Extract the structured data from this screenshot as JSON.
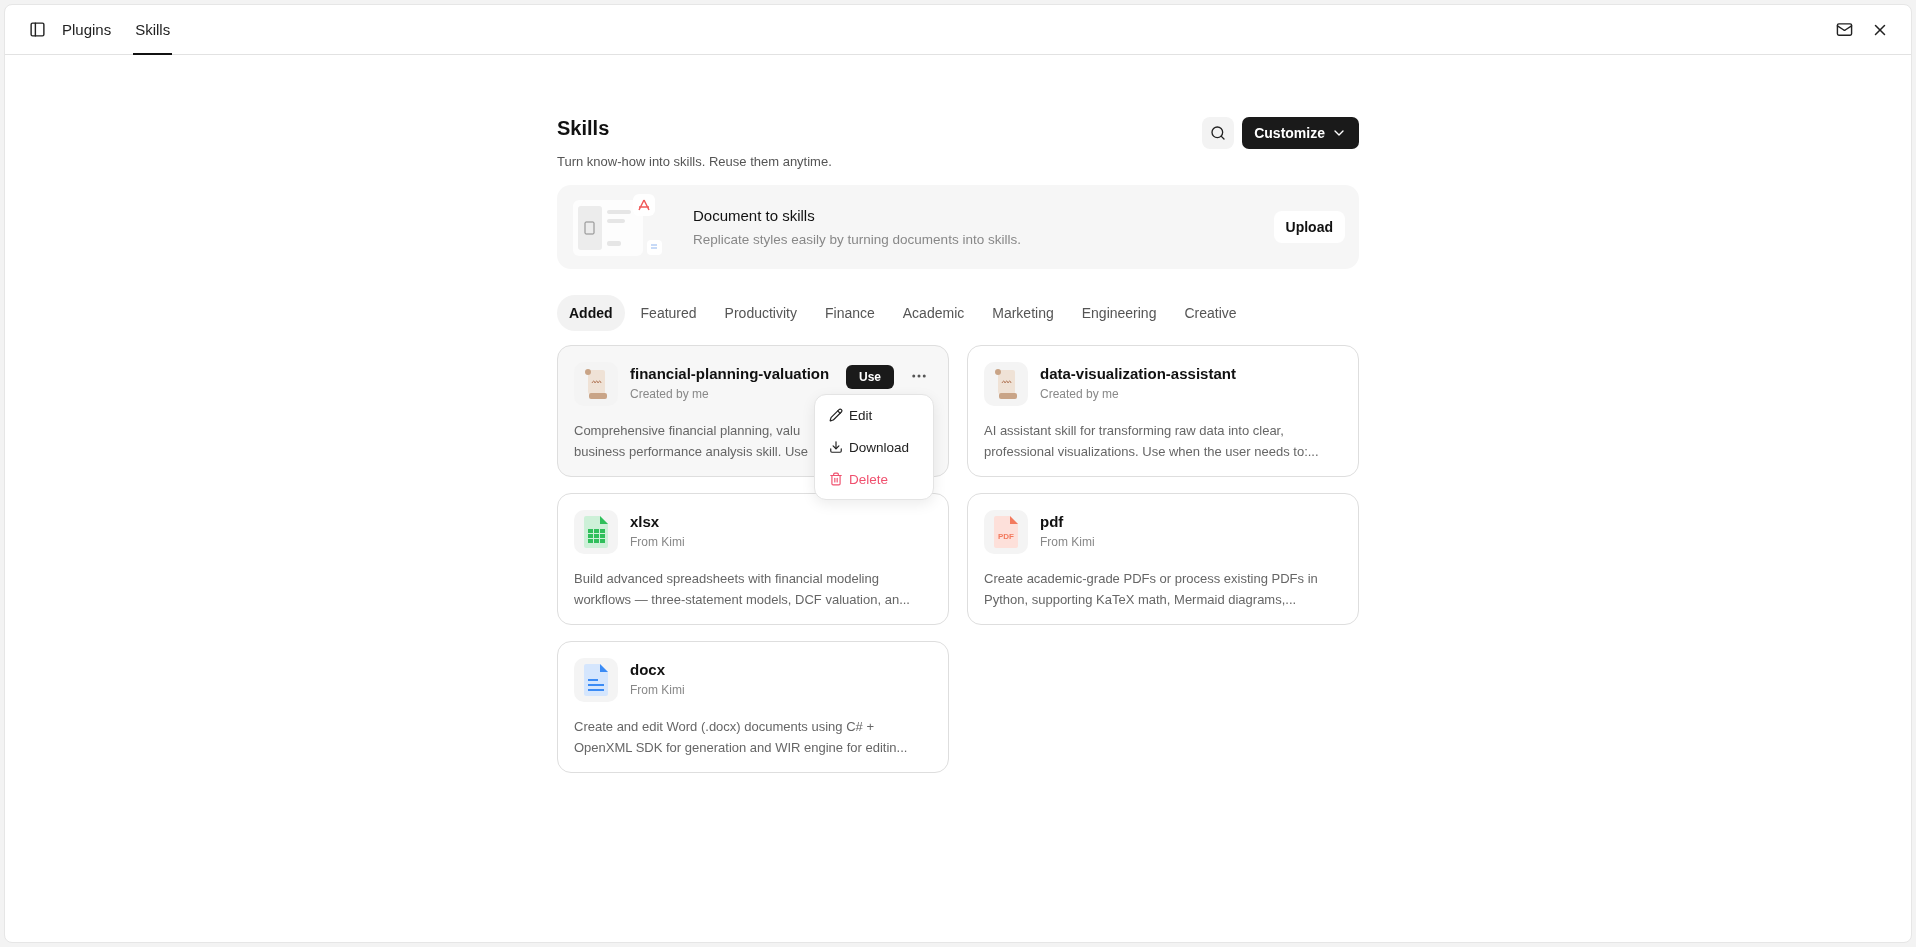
{
  "top_tabs": [
    {
      "label": "Plugins",
      "selected": false
    },
    {
      "label": "Skills",
      "selected": true
    }
  ],
  "header": {
    "title": "Skills",
    "subtitle": "Turn know-how into skills. Reuse them anytime.",
    "customize": "Customize"
  },
  "banner": {
    "title": "Document to skills",
    "subtitle": "Replicate styles easily by turning documents into skills.",
    "button": "Upload"
  },
  "category_tabs": [
    {
      "label": "Added",
      "selected": true
    },
    {
      "label": "Featured",
      "selected": false
    },
    {
      "label": "Productivity",
      "selected": false
    },
    {
      "label": "Finance",
      "selected": false
    },
    {
      "label": "Academic",
      "selected": false
    },
    {
      "label": "Marketing",
      "selected": false
    },
    {
      "label": "Engineering",
      "selected": false
    },
    {
      "label": "Creative",
      "selected": false
    }
  ],
  "cards": [
    {
      "kind": "scroll",
      "name": "financial-planning-valuation",
      "source": "Created by me",
      "description": "Comprehensive financial planning, valu\nbusiness performance analysis skill. Use",
      "hovered": true,
      "use_button": "Use",
      "menu_open": true
    },
    {
      "kind": "scroll",
      "name": "data-visualization-assistant",
      "source": "Created by me",
      "description": "AI assistant skill for transforming raw data into clear,\nprofessional visualizations. Use when the user needs to:...",
      "hovered": false,
      "menu_open": false
    },
    {
      "kind": "sheet",
      "name": "xlsx",
      "source": "From Kimi",
      "description": "Build advanced spreadsheets with financial modeling\nworkflows — three-statement models, DCF valuation, an...",
      "hovered": false,
      "menu_open": false
    },
    {
      "kind": "pdf",
      "name": "pdf",
      "source": "From Kimi",
      "description": "Create academic-grade PDFs or process existing PDFs in\nPython, supporting KaTeX math, Mermaid diagrams,...",
      "hovered": false,
      "menu_open": false,
      "icon_text": "PDF"
    },
    {
      "kind": "doc",
      "name": "docx",
      "source": "From Kimi",
      "description": "Create and edit Word (.docx) documents using C# +\nOpenXML SDK for generation and WIR engine for editin...",
      "hovered": false,
      "menu_open": false
    }
  ],
  "menu": [
    {
      "kind": "edit",
      "label": "Edit",
      "danger": false
    },
    {
      "kind": "download",
      "label": "Download",
      "danger": false
    },
    {
      "kind": "delete",
      "label": "Delete",
      "danger": true
    }
  ]
}
